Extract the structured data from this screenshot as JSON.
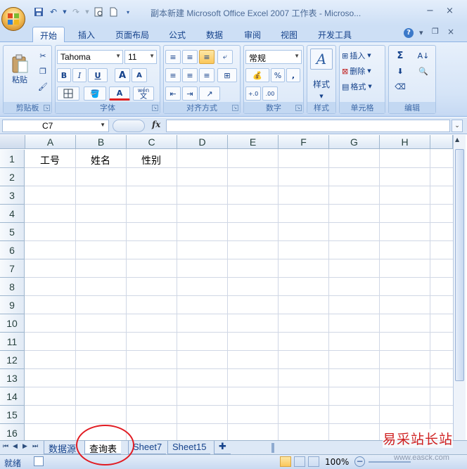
{
  "window": {
    "title": "副本新建 Microsoft Office Excel 2007 工作表 - Microso...",
    "minimize": "−",
    "close": "×"
  },
  "tabs": [
    "开始",
    "插入",
    "页面布局",
    "公式",
    "数据",
    "审阅",
    "视图",
    "开发工具"
  ],
  "ribbon": {
    "clipboard": {
      "label": "剪贴板",
      "paste": "粘贴"
    },
    "font": {
      "label": "字体",
      "name": "Tahoma",
      "size": "11",
      "bold": "B",
      "italic": "I",
      "underline": "U",
      "grow": "A",
      "shrink": "A",
      "color_letter": "A",
      "wen": "wén",
      "wen2": "文"
    },
    "alignment": {
      "label": "对齐方式"
    },
    "number": {
      "label": "数字",
      "format": "常规",
      "percent": "%",
      "comma": ",",
      "inc": "+.0",
      "dec": ".00"
    },
    "styles": {
      "label": "样式",
      "letter": "A"
    },
    "cells": {
      "label": "单元格",
      "insert": "插入",
      "delete": "删除",
      "format": "格式"
    },
    "editing": {
      "label": "编辑",
      "sigma": "Σ"
    }
  },
  "formula_bar": {
    "name_box": "C7",
    "fx": "fx",
    "content": ""
  },
  "grid": {
    "columns": [
      "A",
      "B",
      "C",
      "D",
      "E",
      "F",
      "G",
      "H"
    ],
    "rows": [
      "1",
      "2",
      "3",
      "4",
      "5",
      "6",
      "7",
      "8",
      "9",
      "10",
      "11",
      "12",
      "13",
      "14",
      "15",
      "16"
    ],
    "cells": {
      "A1": "工号",
      "B1": "姓名",
      "C1": "性别"
    }
  },
  "sheets": [
    "数据源",
    "查询表",
    "Sheet7",
    "Sheet15"
  ],
  "active_sheet": "查询表",
  "status": {
    "mode": "就绪",
    "zoom": "100%"
  },
  "watermark": {
    "brand": "易采站长站",
    "url": "www.easck.com"
  },
  "colors": {
    "accent": "#15428b",
    "highlight": "#e11b22"
  }
}
